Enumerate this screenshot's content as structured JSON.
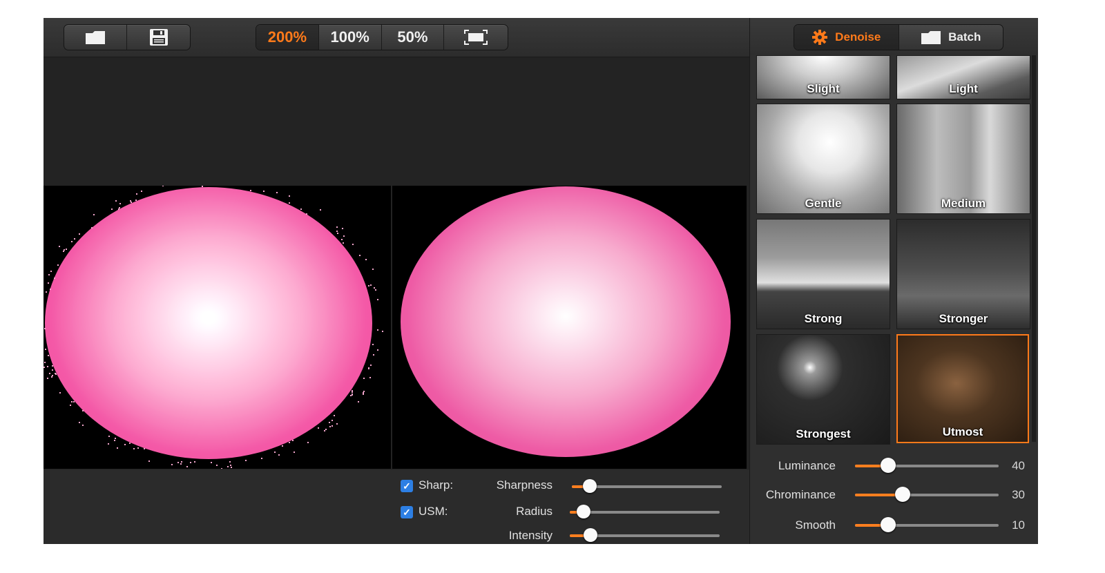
{
  "toolbar": {
    "file_buttons": [
      {
        "icon": "folder-icon"
      },
      {
        "icon": "save-icon"
      }
    ],
    "zoom_options": [
      "200%",
      "100%",
      "50%"
    ],
    "active_zoom": "200%",
    "fit_icon": "fit-screen-icon"
  },
  "mode_tabs": [
    {
      "label": "Denoise",
      "icon": "gear-icon",
      "active": true
    },
    {
      "label": "Batch",
      "icon": "folder-icon",
      "active": false
    }
  ],
  "presets": [
    {
      "label": "Slight"
    },
    {
      "label": "Light"
    },
    {
      "label": "Gentle"
    },
    {
      "label": "Medium"
    },
    {
      "label": "Strong"
    },
    {
      "label": "Stronger"
    },
    {
      "label": "Strongest"
    },
    {
      "label": "Utmost",
      "selected": true
    }
  ],
  "denoise_sliders": [
    {
      "label": "Luminance",
      "value": "40",
      "level": 0.23
    },
    {
      "label": "Chrominance",
      "value": "30",
      "level": 0.33
    },
    {
      "label": "Smooth",
      "value": "10",
      "level": 0.23
    }
  ],
  "sharp": {
    "sharp_label": "Sharp:",
    "sharp_checked": true,
    "usm_label": "USM:",
    "usm_checked": true,
    "sliders": [
      {
        "label": "Sharpness",
        "level": 0.12
      },
      {
        "label": "Radius",
        "level": 0.09
      },
      {
        "label": "Intensity",
        "level": 0.14
      }
    ]
  },
  "colors": {
    "accent": "#ff7a1a",
    "panel": "#2f2f2f",
    "checkbox": "#2d7fe4",
    "ball": "#e8499a"
  }
}
